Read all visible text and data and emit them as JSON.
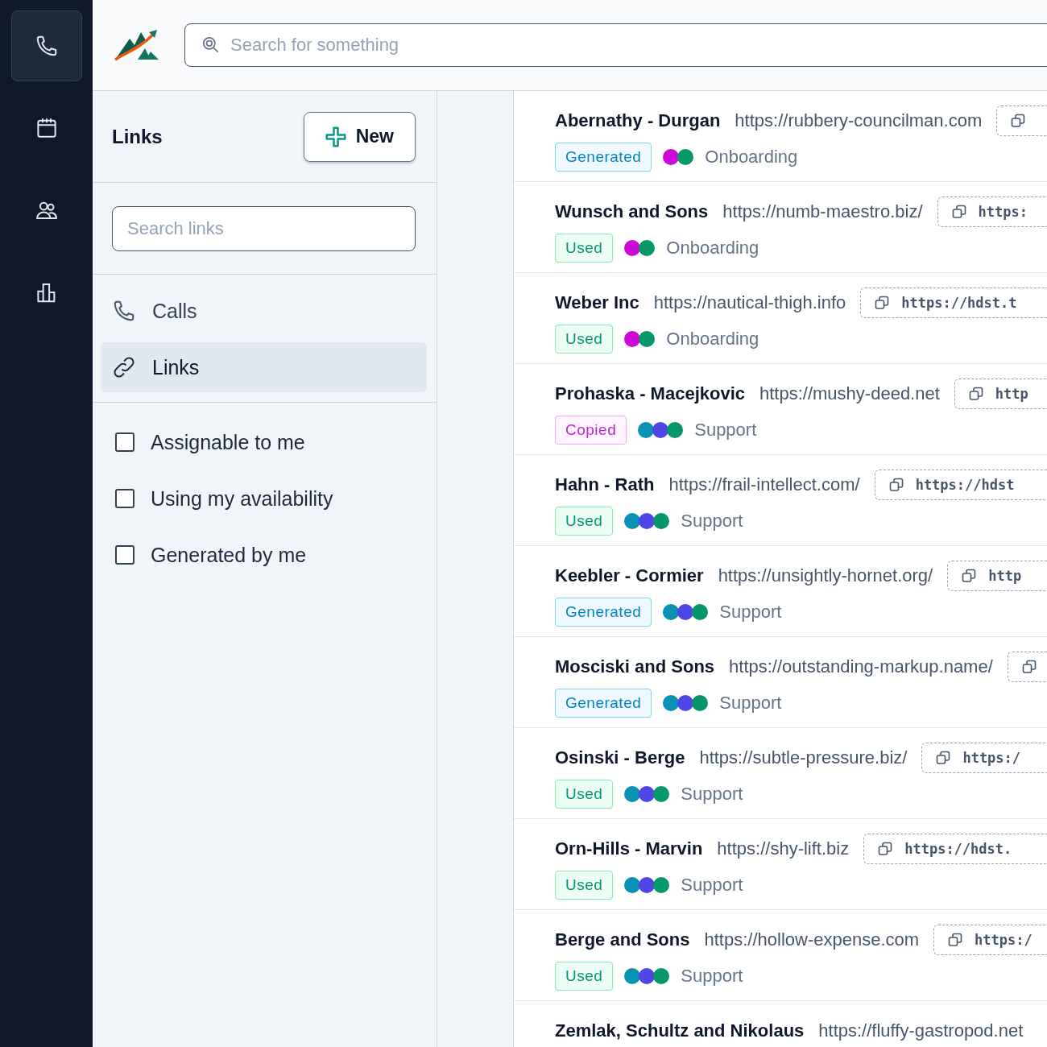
{
  "rail": [
    {
      "selected": true
    },
    {
      "selected": false
    },
    {
      "selected": false
    },
    {
      "selected": false
    }
  ],
  "search": {
    "placeholder": "Search for something"
  },
  "sidebar": {
    "title": "Links",
    "new_button": "New",
    "search": {
      "placeholder": "Search links"
    },
    "nav": [
      {
        "label": "Calls",
        "selected": false
      },
      {
        "label": "Links",
        "selected": true
      }
    ],
    "filters": [
      {
        "label": "Assignable to me",
        "checked": false
      },
      {
        "label": "Using my availability",
        "checked": false
      },
      {
        "label": "Generated by me",
        "checked": false
      }
    ]
  },
  "links": [
    {
      "name": "Abernathy - Durgan",
      "url": "https://rubbery-councilman.com",
      "tag": {
        "kind": "generated",
        "label": "Generated"
      },
      "dots": [
        {
          "color": "#cc0ad6"
        },
        {
          "color": "#059669"
        }
      ],
      "team": "Onboarding"
    },
    {
      "name": "Wunsch and Sons",
      "url": "https://numb-maestro.biz/",
      "copy": "https:",
      "tag": {
        "kind": "used",
        "label": "Used"
      },
      "dots": [
        {
          "color": "#cc0ad6"
        },
        {
          "color": "#059669"
        }
      ],
      "team": "Onboarding"
    },
    {
      "name": "Weber Inc",
      "url": "https://nautical-thigh.info",
      "copy": "https://hdst.t",
      "tag": {
        "kind": "used",
        "label": "Used"
      },
      "dots": [
        {
          "color": "#cc0ad6"
        },
        {
          "color": "#059669"
        }
      ],
      "team": "Onboarding"
    },
    {
      "name": "Prohaska - Macejkovic",
      "url": "https://mushy-deed.net",
      "copy": "http",
      "tag": {
        "kind": "copied",
        "label": "Copied"
      },
      "dots": [
        {
          "color": "#0891b2"
        },
        {
          "color": "#4f46e5"
        },
        {
          "color": "#059669"
        }
      ],
      "team": "Support"
    },
    {
      "name": "Hahn - Rath",
      "url": "https://frail-intellect.com/",
      "copy": "https://hdst",
      "tag": {
        "kind": "used",
        "label": "Used"
      },
      "dots": [
        {
          "color": "#0891b2"
        },
        {
          "color": "#4f46e5"
        },
        {
          "color": "#059669"
        }
      ],
      "team": "Support"
    },
    {
      "name": "Keebler - Cormier",
      "url": "https://unsightly-hornet.org/",
      "copy": "http",
      "tag": {
        "kind": "generated",
        "label": "Generated"
      },
      "dots": [
        {
          "color": "#0891b2"
        },
        {
          "color": "#4f46e5"
        },
        {
          "color": "#059669"
        }
      ],
      "team": "Support"
    },
    {
      "name": "Mosciski and Sons",
      "url": "https://outstanding-markup.name/",
      "tag": {
        "kind": "generated",
        "label": "Generated"
      },
      "dots": [
        {
          "color": "#0891b2"
        },
        {
          "color": "#4f46e5"
        },
        {
          "color": "#059669"
        }
      ],
      "team": "Support"
    },
    {
      "name": "Osinski - Berge",
      "url": "https://subtle-pressure.biz/",
      "copy": "https:/",
      "tag": {
        "kind": "used",
        "label": "Used"
      },
      "dots": [
        {
          "color": "#0891b2"
        },
        {
          "color": "#4f46e5"
        },
        {
          "color": "#059669"
        }
      ],
      "team": "Support"
    },
    {
      "name": "Orn-Hills - Marvin",
      "url": "https://shy-lift.biz",
      "copy": "https://hdst.",
      "tag": {
        "kind": "used",
        "label": "Used"
      },
      "dots": [
        {
          "color": "#0891b2"
        },
        {
          "color": "#4f46e5"
        },
        {
          "color": "#059669"
        }
      ],
      "team": "Support"
    },
    {
      "name": "Berge and Sons",
      "url": "https://hollow-expense.com",
      "copy": "https:/",
      "tag": {
        "kind": "used",
        "label": "Used"
      },
      "dots": [
        {
          "color": "#0891b2"
        },
        {
          "color": "#4f46e5"
        },
        {
          "color": "#059669"
        }
      ],
      "team": "Support"
    },
    {
      "name": "Zemlak, Schultz and Nikolaus",
      "url": "https://fluffy-gastropod.net"
    }
  ]
}
